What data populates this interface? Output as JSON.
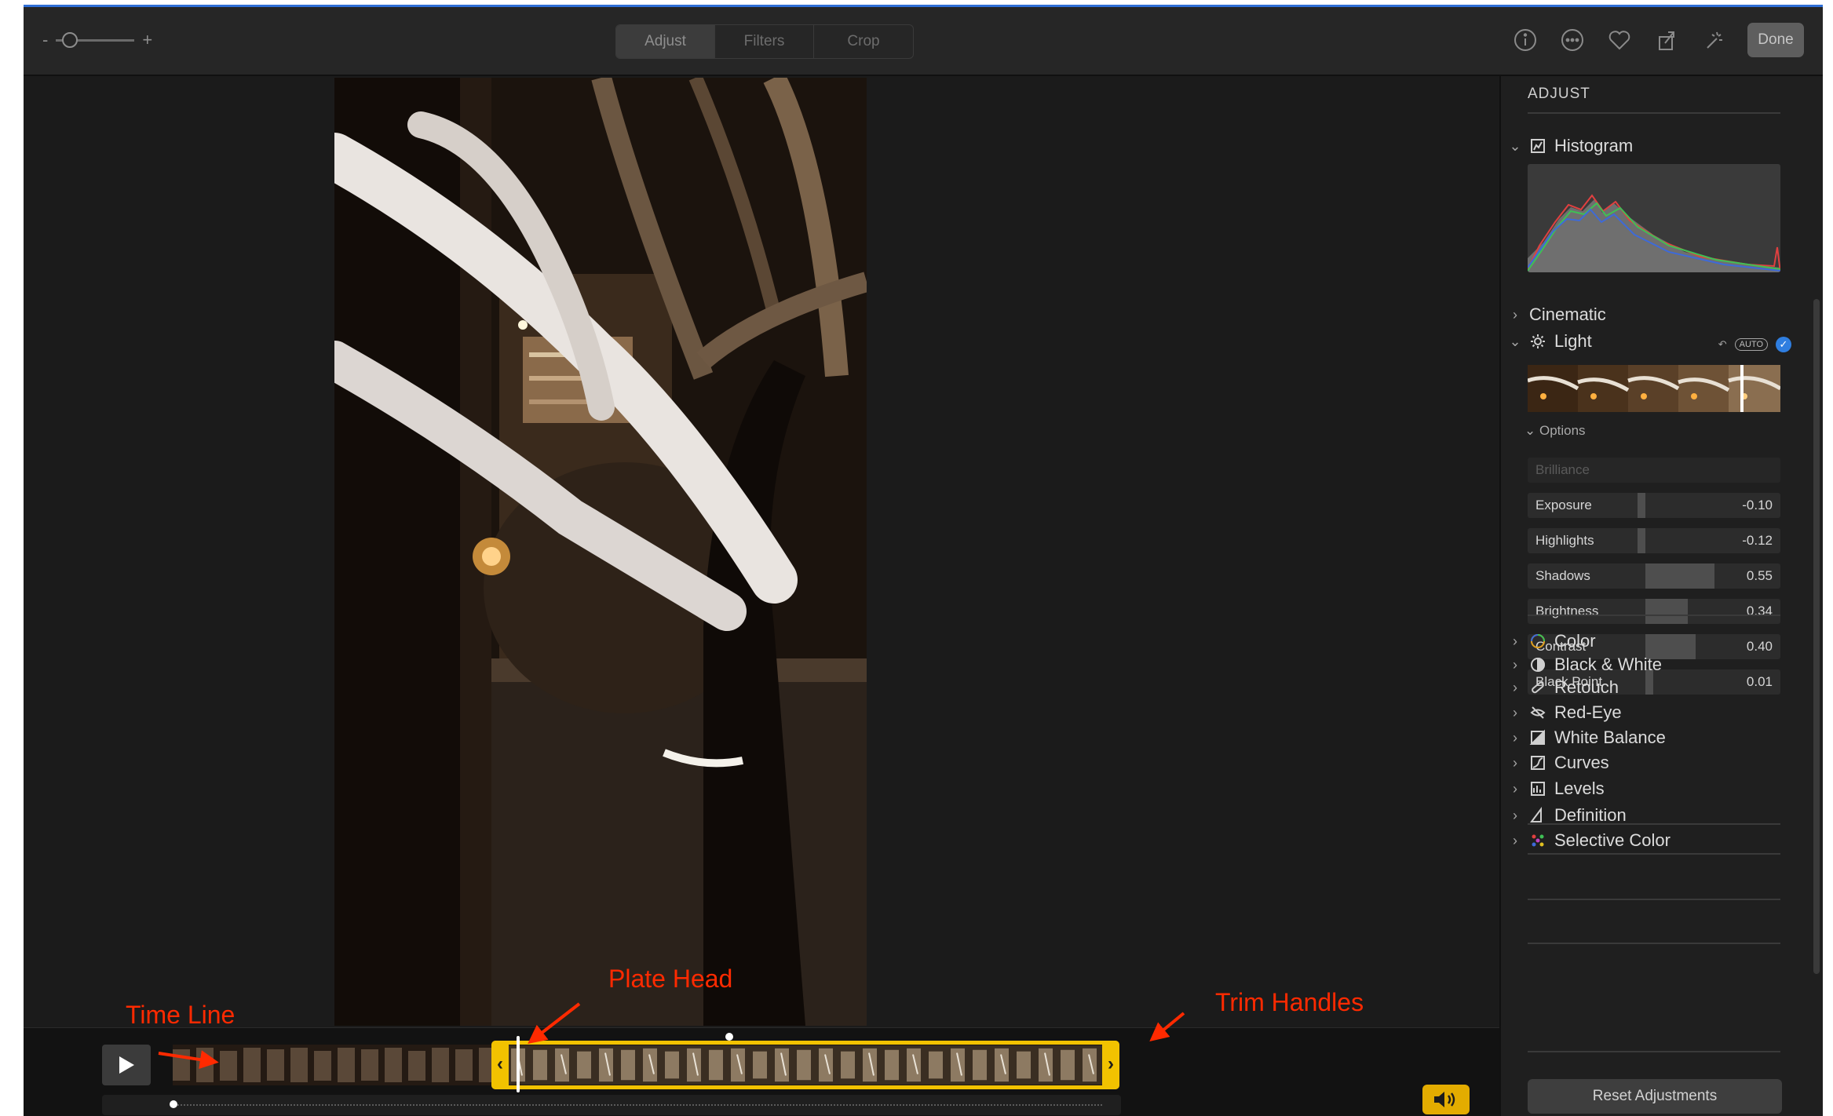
{
  "toolbar": {
    "zoom_minus": "-",
    "zoom_plus": "+",
    "tabs": [
      {
        "label": "Adjust",
        "active": true
      },
      {
        "label": "Filters",
        "active": false
      },
      {
        "label": "Crop",
        "active": false
      }
    ],
    "icons": [
      "info-icon",
      "more-icon",
      "favorite-icon",
      "share-icon",
      "magic-wand-icon"
    ],
    "done_label": "Done"
  },
  "annotations": {
    "timeline": "Time Line",
    "playhead": "Plate Head",
    "trim_handles": "Trim Handles",
    "color": "#ff2a00"
  },
  "timeline": {
    "play_icon": "play-icon",
    "volume_icon": "speaker-icon",
    "trim_color": "#f2c200"
  },
  "sidebar": {
    "title": "ADJUST",
    "histogram_label": "Histogram",
    "cinematic_label": "Cinematic",
    "light": {
      "label": "Light",
      "auto_label": "AUTO",
      "options_label": "Options",
      "sliders": [
        {
          "label": "Brilliance",
          "value": "",
          "level": 0
        },
        {
          "label": "Exposure",
          "value": "-0.10",
          "level": -0.05
        },
        {
          "label": "Highlights",
          "value": "-0.12",
          "level": -0.06
        },
        {
          "label": "Shadows",
          "value": "0.55",
          "level": 0.55
        },
        {
          "label": "Brightness",
          "value": "0.34",
          "level": 0.34
        },
        {
          "label": "Contrast",
          "value": "0.40",
          "level": 0.4
        },
        {
          "label": "Black Point",
          "value": "0.01",
          "level": 0.01
        }
      ]
    },
    "sections": [
      {
        "label": "Color",
        "icon": "color-wheel-icon"
      },
      {
        "label": "Black & White",
        "icon": "black-white-icon"
      },
      {
        "label": "Retouch",
        "icon": "bandage-icon"
      },
      {
        "label": "Red-Eye",
        "icon": "red-eye-icon"
      },
      {
        "label": "White Balance",
        "icon": "white-balance-icon"
      },
      {
        "label": "Curves",
        "icon": "curves-icon"
      },
      {
        "label": "Levels",
        "icon": "levels-icon"
      },
      {
        "label": "Definition",
        "icon": "definition-icon"
      },
      {
        "label": "Selective Color",
        "icon": "selective-color-icon"
      }
    ],
    "reset_label": "Reset Adjustments",
    "accent": "#2f7ee0"
  }
}
